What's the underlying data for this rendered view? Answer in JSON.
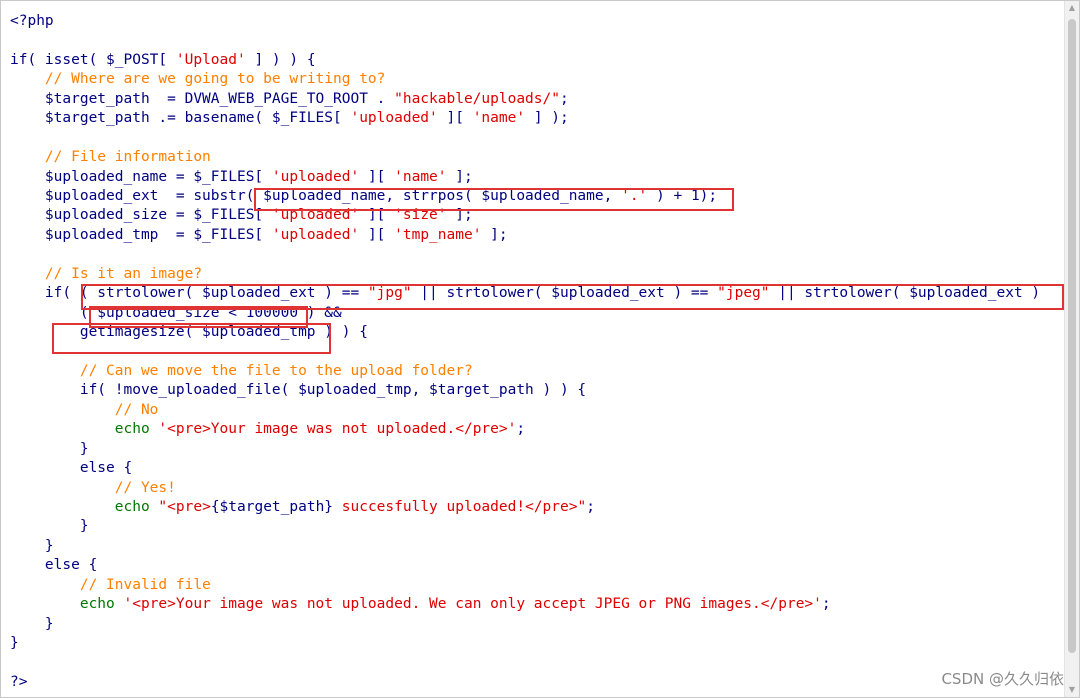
{
  "code": {
    "lines": [
      [
        [
          "<?php",
          "plain"
        ]
      ],
      [],
      [
        [
          "if( isset( $_POST[ ",
          "plain"
        ],
        [
          "'Upload'",
          "str"
        ],
        [
          " ] ) ) {",
          "plain"
        ]
      ],
      [
        [
          "    ",
          "plain"
        ],
        [
          "// Where are we going to be writing to?",
          "com"
        ]
      ],
      [
        [
          "    $target_path  = DVWA_WEB_PAGE_TO_ROOT . ",
          "plain"
        ],
        [
          "\"hackable/uploads/\"",
          "str"
        ],
        [
          ";",
          "plain"
        ]
      ],
      [
        [
          "    $target_path .= basename( $_FILES[ ",
          "plain"
        ],
        [
          "'uploaded'",
          "str"
        ],
        [
          " ][ ",
          "plain"
        ],
        [
          "'name'",
          "str"
        ],
        [
          " ] );",
          "plain"
        ]
      ],
      [],
      [
        [
          "    ",
          "plain"
        ],
        [
          "// File information",
          "com"
        ]
      ],
      [
        [
          "    $uploaded_name = $_FILES[ ",
          "plain"
        ],
        [
          "'uploaded'",
          "str"
        ],
        [
          " ][ ",
          "plain"
        ],
        [
          "'name'",
          "str"
        ],
        [
          " ];",
          "plain"
        ]
      ],
      [
        [
          "    $uploaded_ext  = substr( $uploaded_name, strrpos( $uploaded_name, ",
          "plain"
        ],
        [
          "'.'",
          "str"
        ],
        [
          " ) + 1);",
          "plain"
        ]
      ],
      [
        [
          "    $uploaded_size = $_FILES[ ",
          "plain"
        ],
        [
          "'uploaded'",
          "str"
        ],
        [
          " ][ ",
          "plain"
        ],
        [
          "'size'",
          "str"
        ],
        [
          " ];",
          "plain"
        ]
      ],
      [
        [
          "    $uploaded_tmp  = $_FILES[ ",
          "plain"
        ],
        [
          "'uploaded'",
          "str"
        ],
        [
          " ][ ",
          "plain"
        ],
        [
          "'tmp_name'",
          "str"
        ],
        [
          " ];",
          "plain"
        ]
      ],
      [],
      [
        [
          "    ",
          "plain"
        ],
        [
          "// Is it an image?",
          "com"
        ]
      ],
      [
        [
          "    if( ( strtolower( $uploaded_ext ) == ",
          "plain"
        ],
        [
          "\"jpg\"",
          "str"
        ],
        [
          " || strtolower( $uploaded_ext ) == ",
          "plain"
        ],
        [
          "\"jpeg\"",
          "str"
        ],
        [
          " || strtolower( $uploaded_ext ) ",
          "plain"
        ]
      ],
      [
        [
          "        ( $uploaded_size < 100000 ) &&",
          "plain"
        ]
      ],
      [
        [
          "        getimagesize( $uploaded_tmp ) ) {",
          "plain"
        ]
      ],
      [],
      [
        [
          "        ",
          "plain"
        ],
        [
          "// Can we move the file to the upload folder?",
          "com"
        ]
      ],
      [
        [
          "        if( !move_uploaded_file( $uploaded_tmp, $target_path ) ) {",
          "plain"
        ]
      ],
      [
        [
          "            ",
          "plain"
        ],
        [
          "// No",
          "com"
        ]
      ],
      [
        [
          "            ",
          "plain"
        ],
        [
          "echo",
          "kw"
        ],
        [
          " ",
          "plain"
        ],
        [
          "'<pre>Your image was not uploaded.</pre>'",
          "str"
        ],
        [
          ";",
          "plain"
        ]
      ],
      [
        [
          "        }",
          "plain"
        ]
      ],
      [
        [
          "        else {",
          "plain"
        ]
      ],
      [
        [
          "            ",
          "plain"
        ],
        [
          "// Yes!",
          "com"
        ]
      ],
      [
        [
          "            ",
          "plain"
        ],
        [
          "echo",
          "kw"
        ],
        [
          " ",
          "plain"
        ],
        [
          "\"<pre>",
          "str"
        ],
        [
          "{$target_path}",
          "plain"
        ],
        [
          " succesfully uploaded!</pre>\"",
          "str"
        ],
        [
          ";",
          "plain"
        ]
      ],
      [
        [
          "        }",
          "plain"
        ]
      ],
      [
        [
          "    }",
          "plain"
        ]
      ],
      [
        [
          "    else {",
          "plain"
        ]
      ],
      [
        [
          "        ",
          "plain"
        ],
        [
          "// Invalid file",
          "com"
        ]
      ],
      [
        [
          "        ",
          "plain"
        ],
        [
          "echo",
          "kw"
        ],
        [
          " ",
          "plain"
        ],
        [
          "'<pre>Your image was not uploaded. We can only accept JPEG or PNG images.</pre>'",
          "str"
        ],
        [
          ";",
          "plain"
        ]
      ],
      [
        [
          "    }",
          "plain"
        ]
      ],
      [
        [
          "}",
          "plain"
        ]
      ],
      [],
      [
        [
          "?>",
          "plain"
        ]
      ]
    ]
  },
  "colors": {
    "plain": "#000080",
    "comment": "#ff8000",
    "string": "#dd0000",
    "keyword": "#007700",
    "highlight_box": "#e03434"
  },
  "icons": {
    "scroll_up": "scroll-up-arrow-icon",
    "scroll_down": "scroll-down-arrow-icon"
  },
  "watermark": "CSDN @久久归依"
}
